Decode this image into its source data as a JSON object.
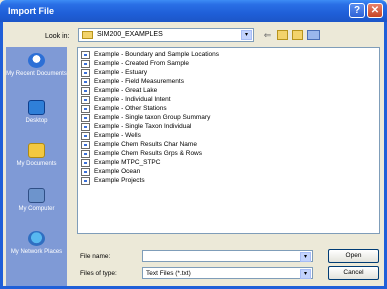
{
  "window": {
    "title": "Import File",
    "help_label": "?",
    "close_label": "✕"
  },
  "toolbar": {
    "look_in_label": "Look in:",
    "look_in_value": "SIM200_EXAMPLES",
    "dropdown_arrow": "▾",
    "back_arrow": "⇐"
  },
  "places": [
    {
      "label": "My Recent Documents",
      "icon": "recent-documents-icon"
    },
    {
      "label": "Desktop",
      "icon": "desktop-icon"
    },
    {
      "label": "My Documents",
      "icon": "my-documents-icon"
    },
    {
      "label": "My Computer",
      "icon": "my-computer-icon"
    },
    {
      "label": "My Network Places",
      "icon": "network-places-icon"
    }
  ],
  "files": [
    "Example - Boundary and Sample Locations",
    "Example - Created From Sample",
    "Example - Estuary",
    "Example - Field Measurements",
    "Example - Great Lake",
    "Example - Individual Intent",
    "Example - Other Stations",
    "Example - Single taxon Group Summary",
    "Example - Single Taxon Individual",
    "Example - Wells",
    "Example Chem Results Char Name",
    "Example Chem Results Grps & Rows",
    "Example MTPC_STPC",
    "Example Ocean",
    "Example Projects"
  ],
  "bottom": {
    "file_name_label": "File name:",
    "file_name_value": "",
    "files_of_type_label": "Files of type:",
    "files_of_type_value": "Text Files (*.txt)",
    "open_label": "Open",
    "cancel_label": "Cancel"
  }
}
